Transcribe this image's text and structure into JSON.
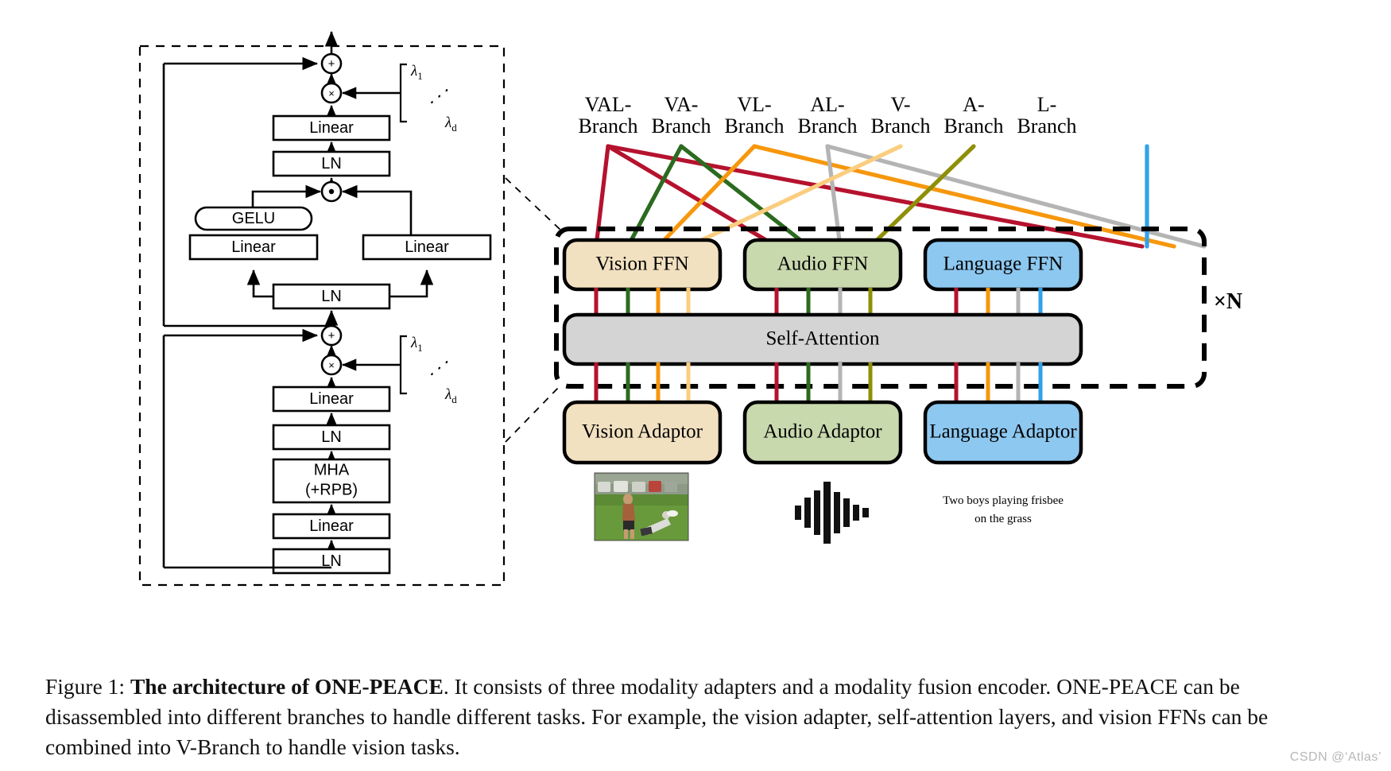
{
  "figure": {
    "caption_prefix": "Figure 1:",
    "caption_bold": "The architecture of ONE-PEACE",
    "caption_rest": ". It consists of three modality adapters and a modality fusion encoder. ONE-PEACE can be disassembled into different branches to handle different tasks. For example, the vision adapter, self-attention layers, and vision FFNs can be combined into V-Branch to handle vision tasks.",
    "watermark": "CSDN @‘Atlas’"
  },
  "left_block": {
    "title": "transformer-block-detail",
    "ffn_sublayer": {
      "add_symbol": "+",
      "mul_symbol": "×",
      "hadamard_symbol": "⊙",
      "linear_out": "Linear",
      "ln_out": "LN",
      "gelu": "GELU",
      "linear_gate": "Linear",
      "linear_value": "Linear",
      "ln_in": "LN",
      "lambda_first": "λ",
      "lambda_first_sub": "1",
      "lambda_last": "λ",
      "lambda_last_sub": "d",
      "lambda_dots": "⋰"
    },
    "attn_sublayer": {
      "add_symbol": "+",
      "mul_symbol": "×",
      "linear_out": "Linear",
      "ln_mid": "LN",
      "mha_line1": "MHA",
      "mha_line2": "(+RPB)",
      "linear_in": "Linear",
      "ln_in": "LN",
      "lambda_first": "λ",
      "lambda_first_sub": "1",
      "lambda_last": "λ",
      "lambda_last_sub": "d",
      "lambda_dots": "⋰"
    }
  },
  "right_block": {
    "repeat_label": "×N",
    "branches": [
      {
        "id": "val",
        "line1": "VAL-",
        "line2": "Branch",
        "color": "#b5122e"
      },
      {
        "id": "va",
        "line1": "VA-",
        "line2": "Branch",
        "color": "#2c6b1f"
      },
      {
        "id": "vl",
        "line1": "VL-",
        "line2": "Branch",
        "color": "#f6970d"
      },
      {
        "id": "al",
        "line1": "AL-",
        "line2": "Branch",
        "color": "#b4b4b4"
      },
      {
        "id": "v",
        "line1": "V-",
        "line2": "Branch",
        "color": "#fbcd7f"
      },
      {
        "id": "a",
        "line1": "A-",
        "line2": "Branch",
        "color": "#8f8f07"
      },
      {
        "id": "l",
        "line1": "L-",
        "line2": "Branch",
        "color": "#31a2e8"
      }
    ],
    "ffn_row": [
      {
        "id": "vision-ffn",
        "label": "Vision FFN",
        "fill": "#f2e1c0"
      },
      {
        "id": "audio-ffn",
        "label": "Audio FFN",
        "fill": "#c9d9ae"
      },
      {
        "id": "language-ffn",
        "label": "Language FFN",
        "fill": "#8dc8f0"
      }
    ],
    "self_attention": {
      "label": "Self-Attention",
      "fill": "#d4d4d4"
    },
    "adaptor_row": [
      {
        "id": "vision-adaptor",
        "label": "Vision Adaptor",
        "fill": "#f2e1c0"
      },
      {
        "id": "audio-adaptor",
        "label": "Audio Adaptor",
        "fill": "#c9d9ae"
      },
      {
        "id": "language-adaptor",
        "label": "Language Adaptor",
        "fill": "#8dc8f0"
      }
    ],
    "inputs": {
      "vision": "frisbee-photo",
      "audio": "audio-waveform",
      "text_line1": "Two boys playing frisbee",
      "text_line2": "on the grass"
    }
  }
}
